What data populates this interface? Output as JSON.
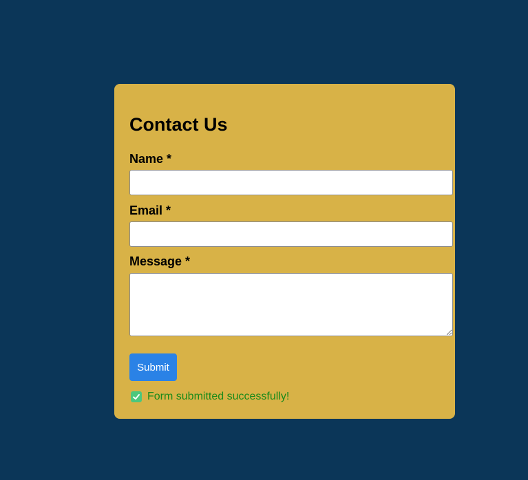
{
  "form": {
    "title": "Contact Us",
    "name_label": "Name *",
    "name_value": "",
    "email_label": "Email *",
    "email_value": "",
    "message_label": "Message *",
    "message_value": "",
    "submit_label": "Submit",
    "status_message": "Form submitted successfully!",
    "status_icon": "check-box-icon"
  },
  "colors": {
    "background": "#0b3658",
    "card": "#d8b247",
    "button": "#2a82e6",
    "success_text": "#1a8a1a",
    "check_icon": "#4cc77d"
  }
}
